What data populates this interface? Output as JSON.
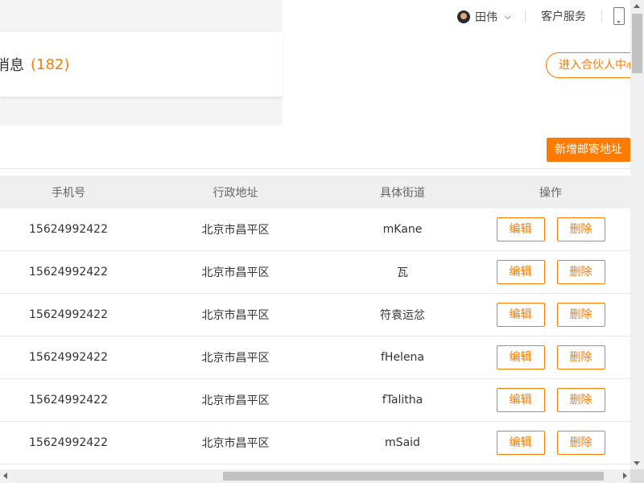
{
  "header": {
    "user_name": "田伟",
    "service_label": "客户服务"
  },
  "messages": {
    "label": "消息",
    "count": "(182)"
  },
  "partner_button": "进入合伙人中心",
  "add_address_button": "新增邮寄地址",
  "table": {
    "columns": [
      "手机号",
      "行政地址",
      "具体街道",
      "操作"
    ],
    "rows": [
      {
        "phone": "15624992422",
        "region": "北京市昌平区",
        "street": "mKane"
      },
      {
        "phone": "15624992422",
        "region": "北京市昌平区",
        "street": "瓦"
      },
      {
        "phone": "15624992422",
        "region": "北京市昌平区",
        "street": "符袁运忿"
      },
      {
        "phone": "15624992422",
        "region": "北京市昌平区",
        "street": "fHelena"
      },
      {
        "phone": "15624992422",
        "region": "北京市昌平区",
        "street": "fTalitha"
      },
      {
        "phone": "15624992422",
        "region": "北京市昌平区",
        "street": "mSaid"
      }
    ],
    "edit_label": "编辑",
    "delete_label": "删除"
  },
  "colors": {
    "accent": "#ff7a00"
  }
}
